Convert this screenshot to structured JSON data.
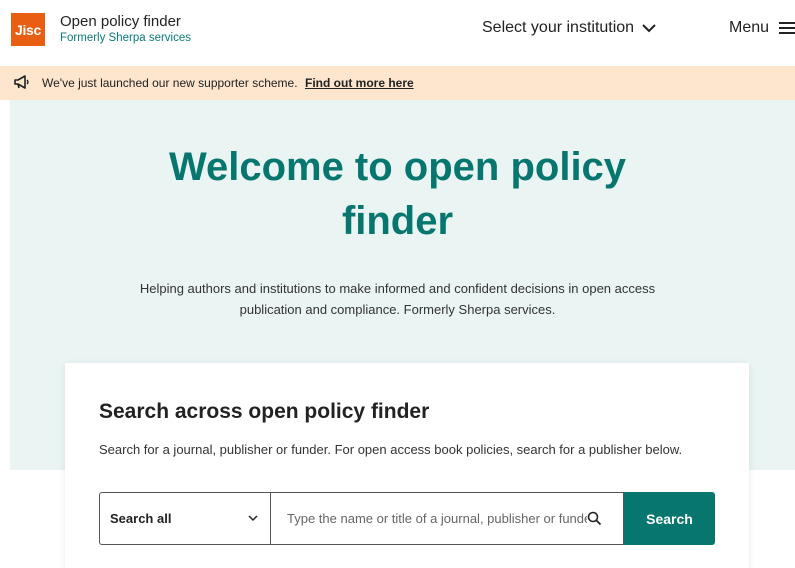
{
  "header": {
    "logo_text": "Jisc",
    "brand_title": "Open policy finder",
    "brand_subtitle": "Formerly Sherpa services",
    "institution_label": "Select your institution",
    "menu_label": "Menu"
  },
  "banner": {
    "text": "We've just launched our new supporter scheme.",
    "link": "Find out more here",
    "icon": "megaphone-icon"
  },
  "hero": {
    "title": "Welcome to open policy finder",
    "description": "Helping authors and institutions to make informed and confident decisions in open access publication and compliance. Formerly Sherpa services."
  },
  "search": {
    "heading": "Search across open policy finder",
    "description": "Search for a journal, publisher or funder. For open access book policies, search for a publisher below.",
    "scope_selected": "Search all",
    "placeholder": "Type the name or title of a journal, publisher or funder",
    "button_label": "Search"
  },
  "colors": {
    "brand": "#e85e13",
    "accent": "#07766f",
    "banner_bg": "#fde6cd",
    "hero_bg": "#e9f4f3"
  }
}
